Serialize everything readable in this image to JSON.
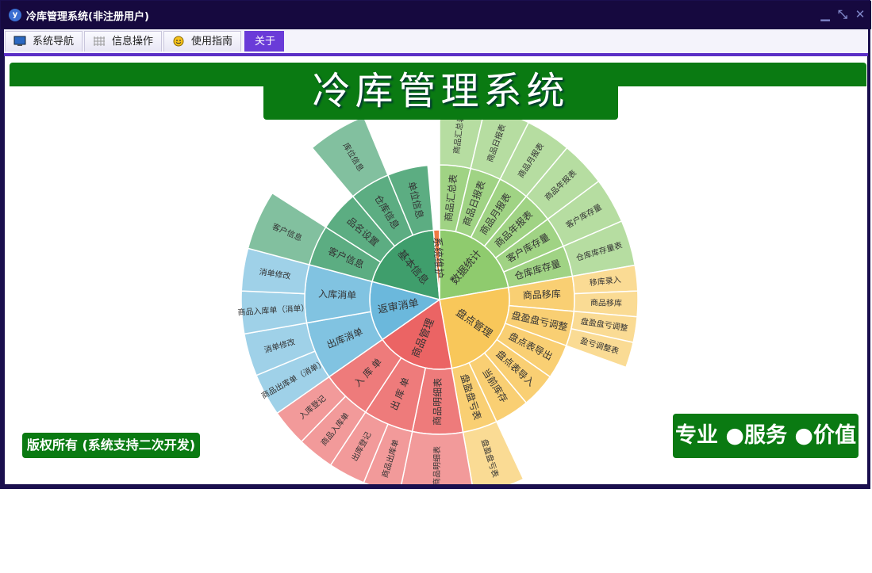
{
  "window": {
    "title": "冷库管理系统(非注册用户)",
    "app_icon": "y-app-icon",
    "controls": [
      "minimize-icon",
      "restore-icon",
      "close-icon"
    ]
  },
  "menu": {
    "tabs": [
      {
        "label": "系统导航",
        "icon": "monitor-icon"
      },
      {
        "label": "信息操作",
        "icon": "grid-icon"
      },
      {
        "label": "使用指南",
        "icon": "smiley-icon"
      },
      {
        "label": "关于",
        "icon": ""
      }
    ],
    "active": "关于"
  },
  "banner": {
    "title": "冷库管理系统",
    "copyright": "版权所有 (系统支持二次开发)",
    "slogan": "专业 ●服务 ●价值"
  },
  "colors": {
    "brand_green": "#0a7a12",
    "titlebar": "#16093f",
    "active_tab": "#6a3bd8"
  },
  "chart_data": {
    "type": "sunburst",
    "groups": [
      {
        "name": "数据统计",
        "color": "#8fcb6e",
        "children": [
          {
            "name": "商品汇总表",
            "leaves": [
              "商品汇总表"
            ]
          },
          {
            "name": "商品日报表",
            "leaves": [
              "商品日报表"
            ]
          },
          {
            "name": "商品月报表",
            "leaves": [
              "商品月报表"
            ]
          },
          {
            "name": "商品年报表",
            "leaves": [
              "商品年报表"
            ]
          },
          {
            "name": "客户库存量",
            "leaves": [
              "客户库存量"
            ]
          },
          {
            "name": "仓库库存量",
            "leaves": [
              "仓库库存量表"
            ]
          }
        ]
      },
      {
        "name": "盘点管理",
        "color": "#f8c75a",
        "children": [
          {
            "name": "商品移库",
            "leaves": [
              "移库录入",
              "商品移库"
            ]
          },
          {
            "name": "盘盈盘亏调整",
            "leaves": [
              "盘盈盘亏调整",
              "盈亏调整表"
            ]
          },
          {
            "name": "盘点表导出",
            "leaves": []
          },
          {
            "name": "盘点表导入",
            "leaves": []
          },
          {
            "name": "当前库存",
            "leaves": []
          },
          {
            "name": "盘盈盘亏表",
            "leaves": [
              "盘盈盘亏表"
            ]
          }
        ]
      },
      {
        "name": "商品管理",
        "color": "#eb6464",
        "children": [
          {
            "name": "商品明细表",
            "leaves": [
              "商品明细表"
            ]
          },
          {
            "name": "出 库 单",
            "leaves": [
              "商品出库单",
              "出库登记"
            ]
          },
          {
            "name": "入 库 单",
            "leaves": [
              "商品入库单",
              "入库登记"
            ]
          }
        ]
      },
      {
        "name": "返审消单",
        "color": "#6bb8dc",
        "children": [
          {
            "name": "出库消单",
            "leaves": [
              "商品出库单（消单）",
              "消单修改"
            ]
          },
          {
            "name": "入库消单",
            "leaves": [
              "商品入库单（消单）",
              "消单修改"
            ]
          }
        ]
      },
      {
        "name": "基本信息",
        "color": "#3f9e6c",
        "children": [
          {
            "name": "客户信息",
            "leaves": [
              "客户信息"
            ]
          },
          {
            "name": "品名设置",
            "leaves": []
          },
          {
            "name": "仓库信息",
            "leaves": [
              "库位信息"
            ]
          },
          {
            "name": "单位信息",
            "leaves": []
          }
        ]
      },
      {
        "name": "系统维护",
        "color": "#f07a45",
        "children": []
      }
    ]
  }
}
